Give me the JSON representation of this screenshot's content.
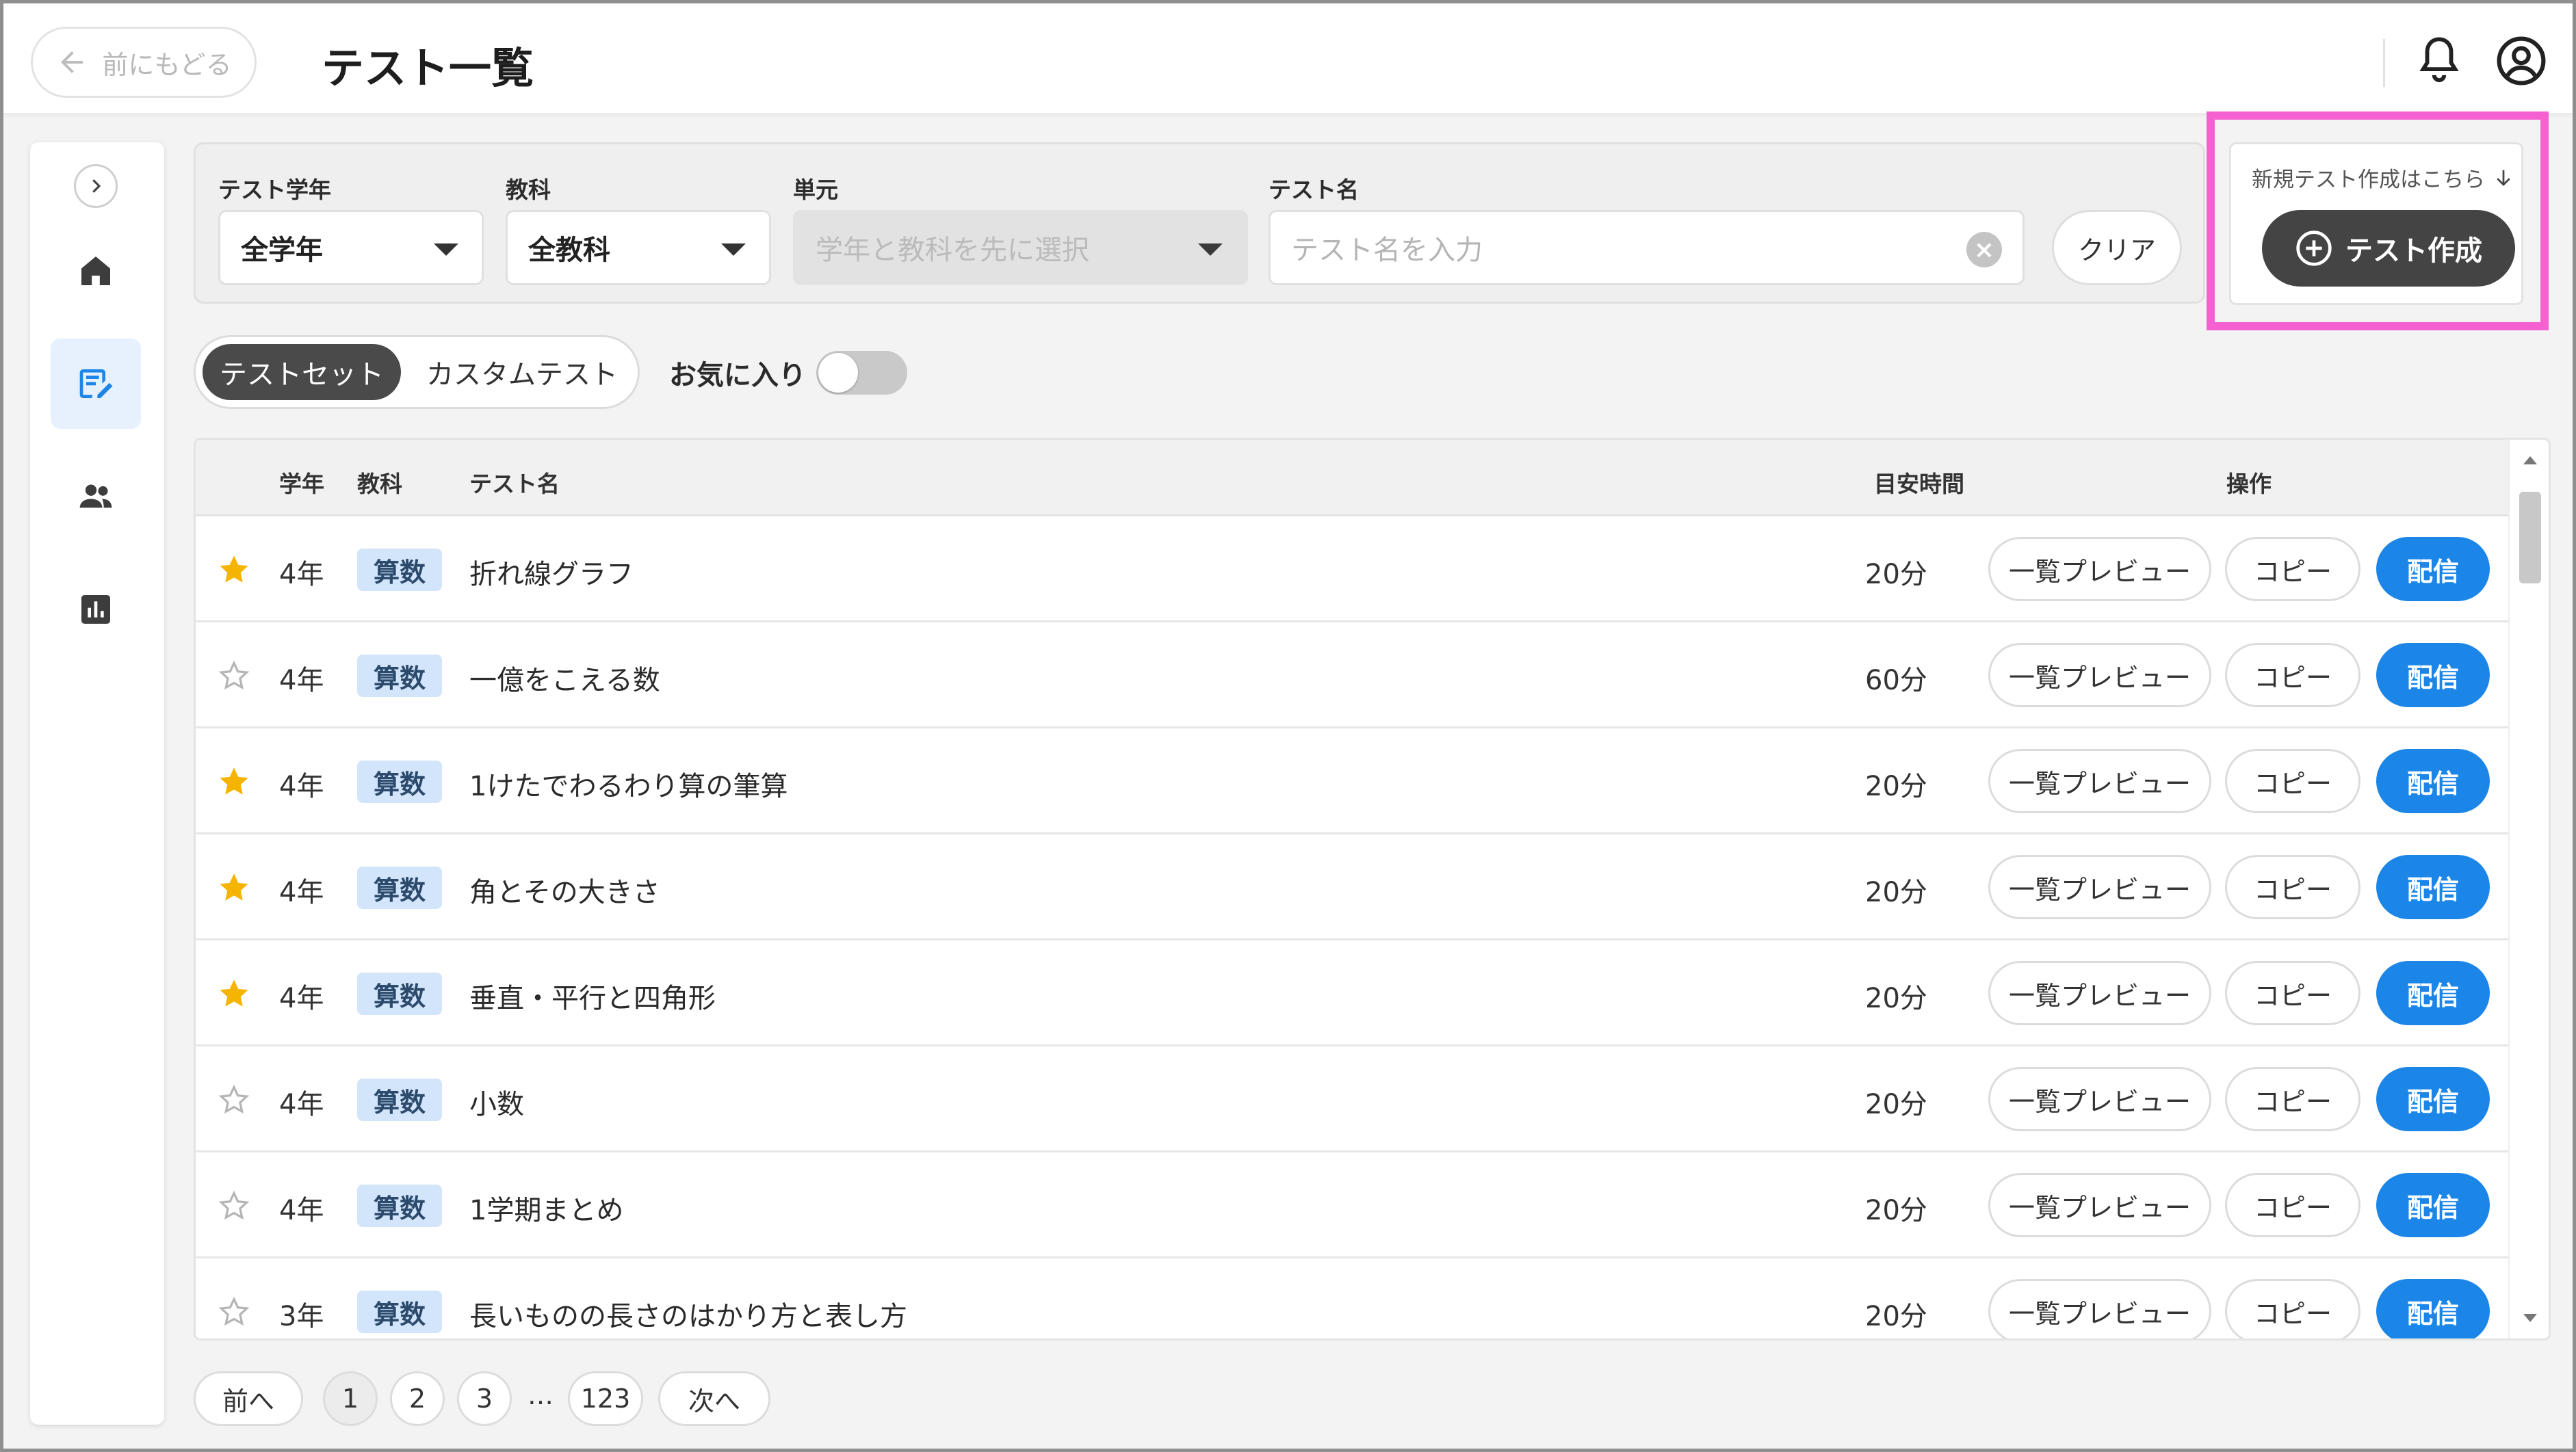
{
  "header": {
    "back_label": "前にもどる",
    "title": "テスト一覧"
  },
  "sidebar": {
    "items": [
      {
        "name": "home",
        "icon": "home-icon"
      },
      {
        "name": "tests",
        "icon": "edit-note-icon",
        "active": true
      },
      {
        "name": "students",
        "icon": "people-icon"
      },
      {
        "name": "reports",
        "icon": "bar-chart-icon"
      }
    ]
  },
  "filters": {
    "grade": {
      "label": "テスト学年",
      "value": "全学年"
    },
    "subject": {
      "label": "教科",
      "value": "全教科"
    },
    "unit": {
      "label": "単元",
      "placeholder": "学年と教科を先に選択"
    },
    "test_name": {
      "label": "テスト名",
      "placeholder": "テスト名を入力"
    },
    "clear_label": "クリア"
  },
  "create": {
    "hint": "新規テスト作成はこちら",
    "button_label": "テスト作成"
  },
  "tabs": [
    {
      "label": "テストセット",
      "active": true
    },
    {
      "label": "カスタムテスト",
      "active": false
    }
  ],
  "favorites": {
    "label": "お気に入り",
    "on": false
  },
  "table": {
    "headers": {
      "grade": "学年",
      "subject": "教科",
      "name": "テスト名",
      "time": "目安時間",
      "actions": "操作"
    },
    "action_labels": {
      "preview": "一覧プレビュー",
      "copy": "コピー",
      "send": "配信"
    },
    "rows": [
      {
        "favorite": true,
        "grade": "4年",
        "subject": "算数",
        "name": "折れ線グラフ",
        "time": "20分"
      },
      {
        "favorite": false,
        "grade": "4年",
        "subject": "算数",
        "name": "一億をこえる数",
        "time": "60分"
      },
      {
        "favorite": true,
        "grade": "4年",
        "subject": "算数",
        "name": "1けたでわるわり算の筆算",
        "time": "20分"
      },
      {
        "favorite": true,
        "grade": "4年",
        "subject": "算数",
        "name": "角とその大きさ",
        "time": "20分"
      },
      {
        "favorite": true,
        "grade": "4年",
        "subject": "算数",
        "name": "垂直・平行と四角形",
        "time": "20分"
      },
      {
        "favorite": false,
        "grade": "4年",
        "subject": "算数",
        "name": "小数",
        "time": "20分"
      },
      {
        "favorite": false,
        "grade": "4年",
        "subject": "算数",
        "name": "1学期まとめ",
        "time": "20分"
      },
      {
        "favorite": false,
        "grade": "3年",
        "subject": "算数",
        "name": "長いものの長さのはかり方と表し方",
        "time": "20分"
      }
    ]
  },
  "pagination": {
    "prev": "前へ",
    "pages": [
      "1",
      "2",
      "3"
    ],
    "ellipsis": "…",
    "last": "123",
    "next": "次へ",
    "current": "1"
  },
  "colors": {
    "accent": "#1c86e8",
    "highlight": "#f661d2",
    "star": "#f5b400",
    "subject_badge": "#d3e5fb"
  }
}
